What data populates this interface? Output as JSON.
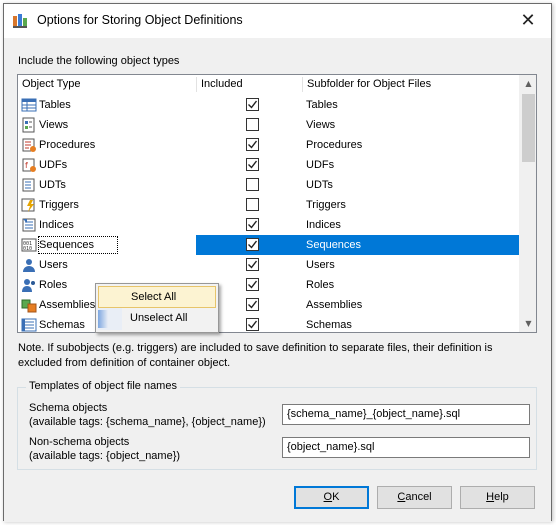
{
  "window": {
    "title": "Options for Storing Object Definitions"
  },
  "include_label": "Include the following object types",
  "columns": {
    "object_type": "Object Type",
    "included": "Included",
    "subfolder": "Subfolder for Object Files"
  },
  "rows": [
    {
      "name": "Tables",
      "icon": "table-icon",
      "included": true,
      "subfolder": "Tables"
    },
    {
      "name": "Views",
      "icon": "view-icon",
      "included": false,
      "subfolder": "Views"
    },
    {
      "name": "Procedures",
      "icon": "procedure-icon",
      "included": true,
      "subfolder": "Procedures"
    },
    {
      "name": "UDFs",
      "icon": "udf-icon",
      "included": true,
      "subfolder": "UDFs"
    },
    {
      "name": "UDTs",
      "icon": "udt-icon",
      "included": false,
      "subfolder": "UDTs"
    },
    {
      "name": "Triggers",
      "icon": "trigger-icon",
      "included": false,
      "subfolder": "Triggers"
    },
    {
      "name": "Indices",
      "icon": "index-icon",
      "included": true,
      "subfolder": "Indices"
    },
    {
      "name": "Sequences",
      "icon": "sequence-icon",
      "included": true,
      "subfolder": "Sequences",
      "selected": true
    },
    {
      "name": "Users",
      "icon": "user-icon",
      "included": true,
      "subfolder": "Users"
    },
    {
      "name": "Roles",
      "icon": "role-icon",
      "included": true,
      "subfolder": "Roles"
    },
    {
      "name": "Assemblies",
      "icon": "assembly-icon",
      "included": true,
      "subfolder": "Assemblies"
    },
    {
      "name": "Schemas",
      "icon": "schema-icon",
      "included": true,
      "subfolder": "Schemas"
    }
  ],
  "context_menu": {
    "select_all": "Select All",
    "unselect_all": "Unselect All"
  },
  "note": "Note. If subobjects (e.g. triggers) are included to save definition to separate files, their definition is excluded from definition of container object.",
  "templates": {
    "legend": "Templates of object file names",
    "schema_label": "Schema objects",
    "schema_tags": "(available tags: {schema_name}, {object_name})",
    "schema_value": "{schema_name}_{object_name}.sql",
    "nonschema_label": "Non-schema objects",
    "nonschema_tags": "(available tags: {object_name})",
    "nonschema_value": "{object_name}.sql"
  },
  "buttons": {
    "ok_accel": "O",
    "ok_rest": "K",
    "cancel_accel": "C",
    "cancel_rest": "ancel",
    "help_accel": "H",
    "help_rest": "elp"
  },
  "colors": {
    "selection": "#0078d7",
    "menu_hover": "#fcf3d2"
  }
}
